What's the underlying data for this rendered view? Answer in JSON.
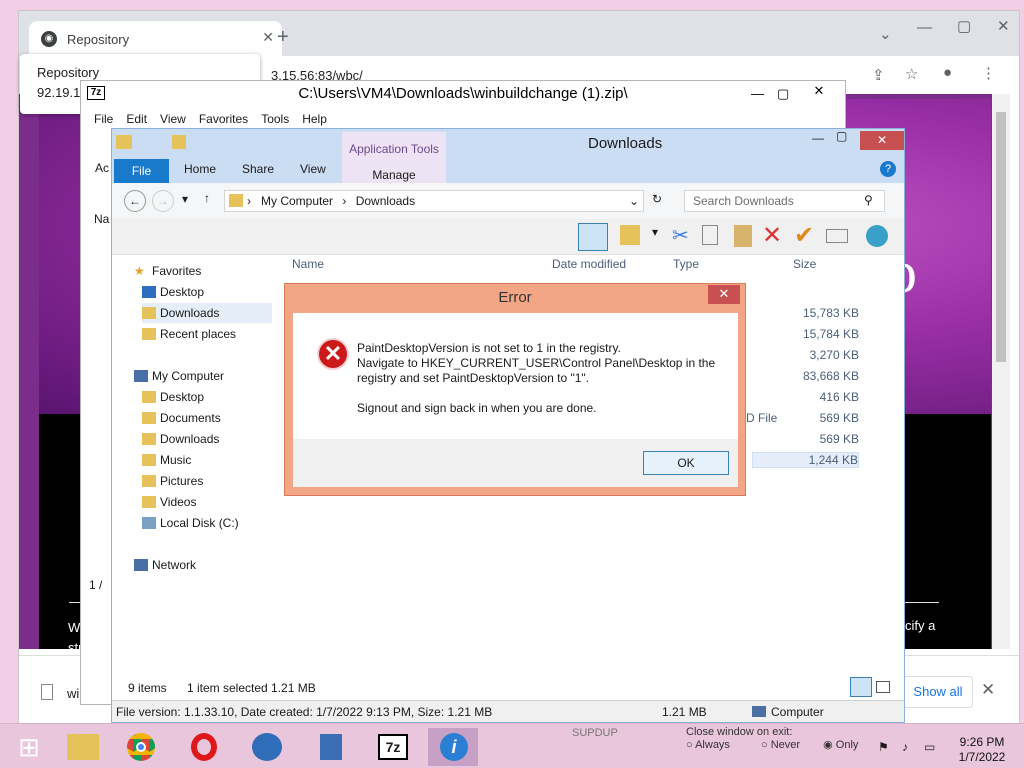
{
  "chrome": {
    "tab_title": "Repository",
    "address": "3.15.56:83/wbc/",
    "tooltip_title": "Repository",
    "tooltip_url": "92.19.1",
    "page_text1": "WBC r",
    "page_text2": "string",
    "page_right": "cify a",
    "big_letter": "o",
    "download_item": "winbui",
    "show_all": "Show all"
  },
  "sevenzip": {
    "title": "C:\\Users\\VM4\\Downloads\\winbuildchange (1).zip\\",
    "menu": [
      "File",
      "Edit",
      "View",
      "Favorites",
      "Tools",
      "Help"
    ],
    "side1": "Ac",
    "side2": "Na",
    "status_frag": "1 /"
  },
  "explorer": {
    "title": "Downloads",
    "tabs": {
      "file": "File",
      "home": "Home",
      "share": "Share",
      "view": "View",
      "app_tools": "Application Tools",
      "manage": "Manage"
    },
    "path": [
      "My Computer",
      "Downloads"
    ],
    "search_placeholder": "Search Downloads",
    "columns": {
      "name": "Name",
      "date": "Date modified",
      "type": "Type",
      "size": "Size"
    },
    "sizes": [
      "15,783 KB",
      "15,784 KB",
      "3,270 KB",
      "83,668 KB",
      "416 KB",
      "569 KB",
      "569 KB",
      "1,244 KB"
    ],
    "type_frag": "D File",
    "nav": {
      "favorites": "Favorites",
      "fav_items": [
        "Desktop",
        "Downloads",
        "Recent places"
      ],
      "computer": "My Computer",
      "comp_items": [
        "Desktop",
        "Documents",
        "Downloads",
        "Music",
        "Pictures",
        "Videos",
        "Local Disk (C:)"
      ],
      "network": "Network"
    },
    "status": {
      "items": "9 items",
      "selected": "1 item selected  1.21 MB"
    },
    "footer": {
      "info": "File version: 1.1.33.10, Date created: 1/7/2022 9:13 PM, Size: 1.21 MB",
      "size": "1.21 MB",
      "location": "Computer"
    }
  },
  "error": {
    "title": "Error",
    "line1": "PaintDesktopVersion is not set to 1 in the registry.",
    "line2": "Navigate to HKEY_CURRENT_USER\\Control Panel\\Desktop in the",
    "line3": "registry and set PaintDesktopVersion to \"1\".",
    "line4": "Signout and sign back in when you are done.",
    "ok": "OK"
  },
  "taskbar": {
    "time": "9:26 PM",
    "date": "1/7/2022",
    "close_label": "Close window on exit:",
    "opt_always": "Always",
    "opt_never": "Never",
    "opt_only": "Only",
    "frag": "SUPDUP"
  },
  "colors": {
    "accent": "#1979ca",
    "error_border": "#f3a685",
    "page_purple": "#9a2fa6"
  },
  "icons": [
    "folder-icon",
    "chrome-icon",
    "opera-icon",
    "thunderbird-icon",
    "network-icon",
    "7zip-icon",
    "info-icon",
    "error-icon",
    "search-icon"
  ]
}
